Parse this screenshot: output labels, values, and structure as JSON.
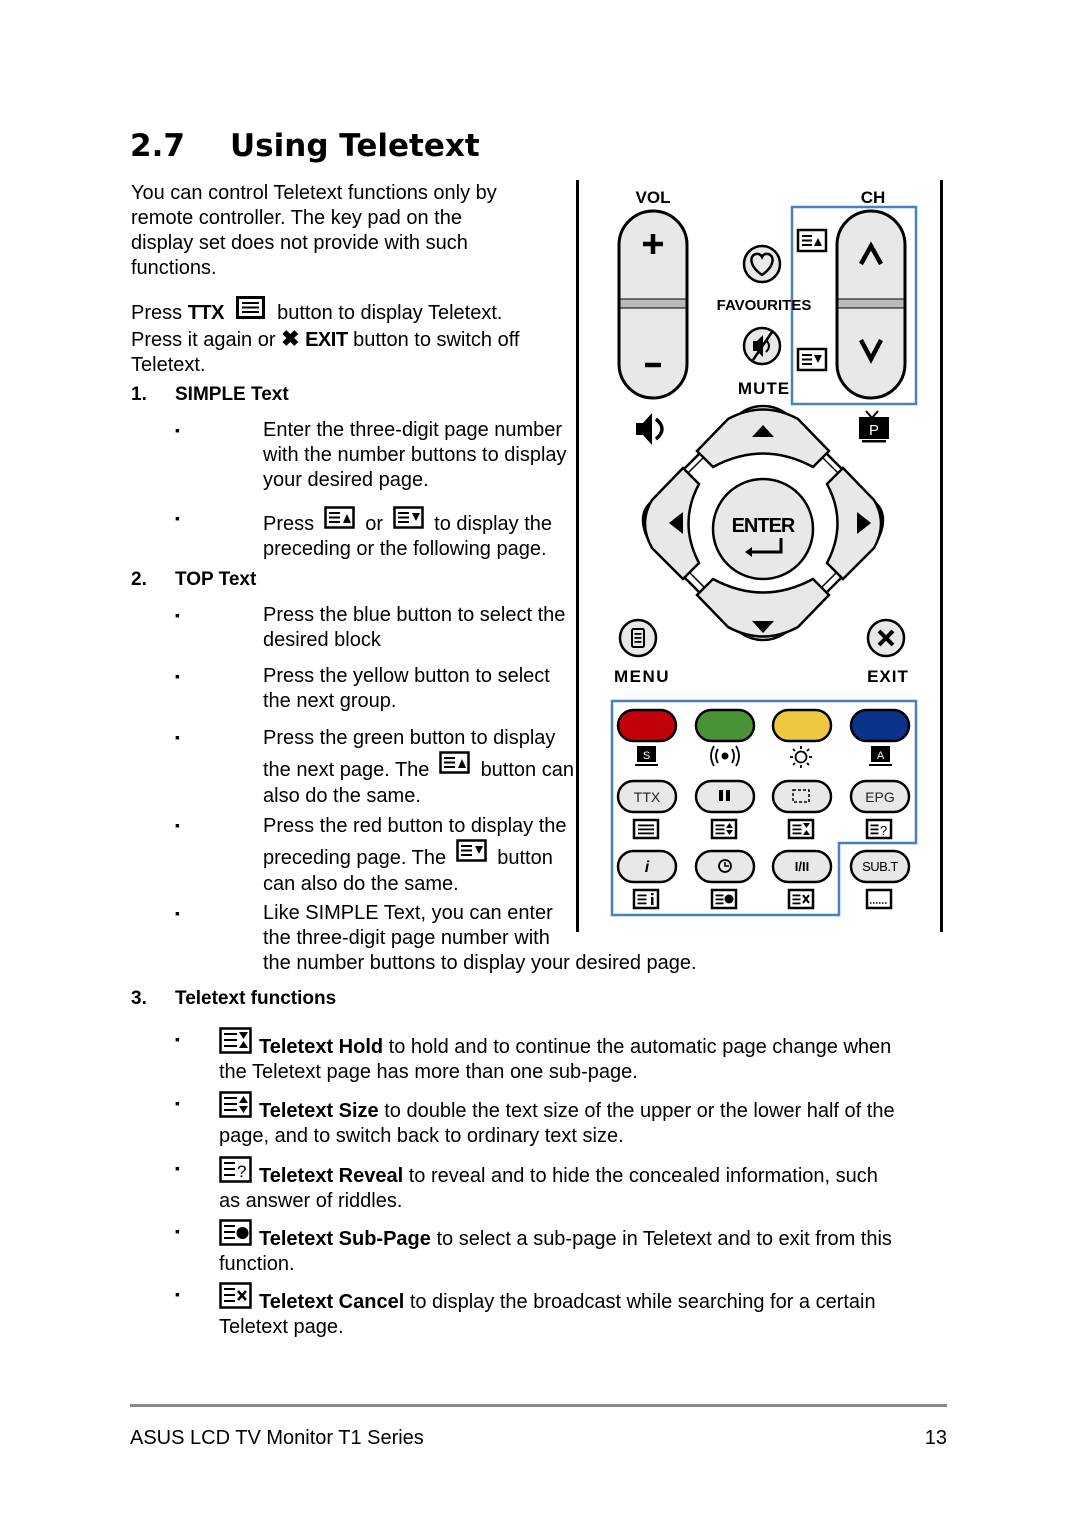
{
  "heading": {
    "number": "2.7",
    "title": "Using Teletext"
  },
  "intro": [
    "You can control Teletext functions only by",
    "remote controller. The key pad on the",
    "display set does not provide with such",
    "functions."
  ],
  "press_ttx": {
    "pre": "Press",
    "ttx": "TTX",
    "post": "button to display Teletext.",
    "line2_pre": "Press it again or",
    "exit": "EXIT",
    "line2_post": "button to switch off",
    "line3": "Teletext."
  },
  "sections": [
    {
      "number": "1.",
      "title": "SIMPLE Text",
      "bullets": [
        {
          "lines": [
            "Enter the three-digit page number",
            "with the number buttons to display",
            "your desired page."
          ]
        },
        {
          "pre": "Press",
          "mid": "or",
          "post": "to display the",
          "line2": "preceding or the following page."
        }
      ]
    },
    {
      "number": "2.",
      "title": "TOP Text",
      "bullets": [
        {
          "lines": [
            "Press the blue button to select the",
            "desired block"
          ]
        },
        {
          "lines": [
            "Press the yellow button to select",
            "the next group."
          ]
        },
        {
          "line1": "Press the green button to display",
          "pre": "the next page. The",
          "post": "button can",
          "line3": "also do the same."
        },
        {
          "line1": "Press the red button to display the",
          "pre": "preceding page. The",
          "post": "button",
          "line3": "can also do the same."
        },
        {
          "lines": [
            "Like SIMPLE Text, you can enter",
            "the three-digit page number with",
            "the number buttons to display your desired page."
          ]
        }
      ]
    },
    {
      "number": "3.",
      "title": "Teletext functions",
      "items": [
        {
          "icon": "teletext-hold-icon",
          "name": "Teletext Hold",
          "desc": "to hold and to continue the automatic page change when",
          "line2": "the Teletext page has more than one sub-page."
        },
        {
          "icon": "teletext-size-icon",
          "name": "Teletext Size",
          "desc": "to double the text size of the upper or the lower half of the",
          "line2": "page, and to switch back to ordinary text size."
        },
        {
          "icon": "teletext-reveal-icon",
          "name": "Teletext Reveal",
          "desc": "to reveal and to hide the concealed information, such",
          "line2": "as answer of riddles."
        },
        {
          "icon": "teletext-subpage-icon",
          "name": "Teletext Sub-Page",
          "desc": "to select a sub-page in Teletext and to exit from this",
          "line2": "function."
        },
        {
          "icon": "teletext-cancel-icon",
          "name": "Teletext Cancel",
          "desc": "to display the broadcast while searching for a certain",
          "line2": "Teletext page."
        }
      ]
    }
  ],
  "remote": {
    "vol_label": "VOL",
    "ch_label": "CH",
    "favourites_label": "FAVOURITES",
    "mute_label": "MUTE",
    "enter_label": "ENTER",
    "menu_label": "MENU",
    "exit_label": "EXIT",
    "pip_label": "P",
    "s_label": "S",
    "a_label": "A",
    "ttx_label": "TTX",
    "epg_label": "EPG",
    "info_label": "i",
    "dual_label": "I/II",
    "subt_label": "SUB.T",
    "colors": {
      "red": "#c0000b",
      "green": "#4a9236",
      "yellow": "#eec841",
      "blue": "#0a3389",
      "highlight": "#4a7fc1",
      "key": "#e8e8e8"
    }
  },
  "footer": {
    "title": "ASUS LCD TV Monitor T1 Series",
    "page": "13"
  }
}
